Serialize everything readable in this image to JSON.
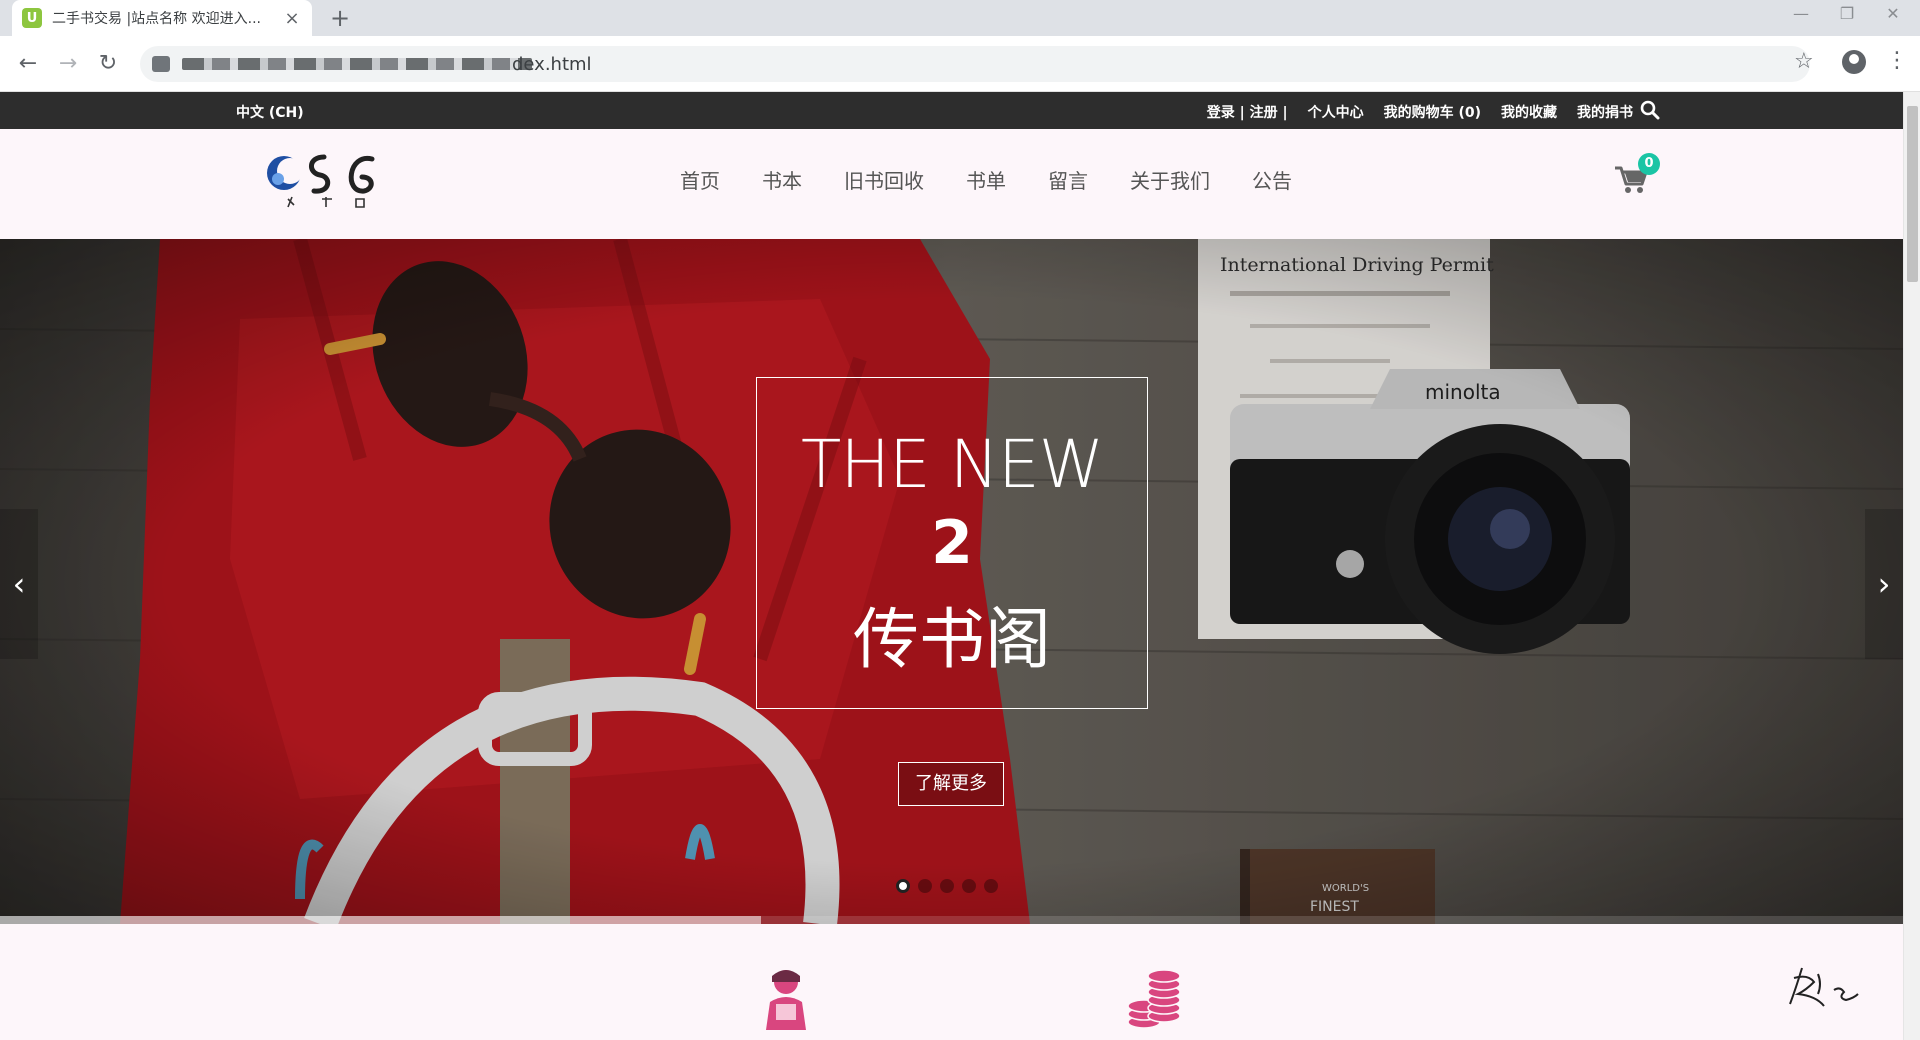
{
  "browser": {
    "tab_title": "二手书交易 |站点名称 欢迎进入...",
    "tab_favicon": "U",
    "tab_close": "×",
    "new_tab": "+",
    "url_text": "dex.html"
  },
  "topbar": {
    "language": "中文 (CH)",
    "links": [
      "登录 | 注册 |",
      "个人中心",
      "我的购物车 (0)",
      "我的收藏",
      "我的捐书"
    ]
  },
  "nav": {
    "menu": [
      "首页",
      "书本",
      "旧书回收",
      "书单",
      "留言",
      "关于我们",
      "公告"
    ],
    "cart_count": "0"
  },
  "hero": {
    "caption_line1": "THE NEW",
    "caption_line2": "2",
    "caption_line3": "传书阁",
    "button": "了解更多",
    "prev": "‹",
    "next": "›",
    "slide_count": 5,
    "active_slide": 1,
    "progress_fraction": 0.4
  },
  "colors": {
    "topbar_bg": "#2d2d2d",
    "page_bg": "#fdf6fa",
    "cart_badge": "#1bc5a5",
    "feature_icon": "#d9467f",
    "menu_text": "#555555"
  },
  "icons": {
    "search": "search-icon",
    "cart": "shopping-cart-icon",
    "feature_1": "user-icon",
    "feature_2": "coins-icon"
  }
}
